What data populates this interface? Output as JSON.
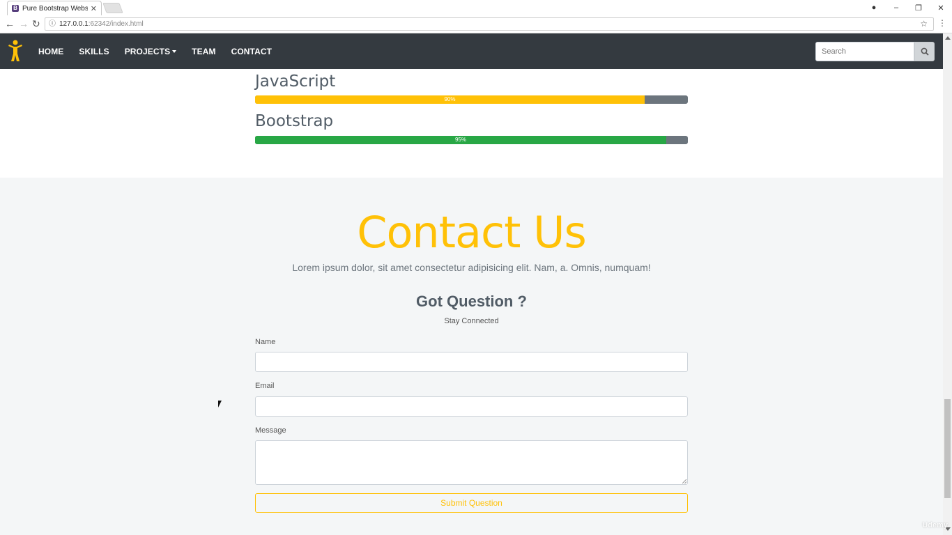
{
  "browser": {
    "tab_title": "Pure Bootstrap Website",
    "tab_favicon": "B",
    "url_host": "127.0.0.1",
    "url_rest": ":62342/index.html"
  },
  "navbar": {
    "links": [
      "HOME",
      "SKILLS",
      "PROJECTS",
      "TEAM",
      "CONTACT"
    ],
    "search_placeholder": "Search"
  },
  "skills": [
    {
      "name": "JavaScript",
      "percent": 90,
      "label": "90%",
      "color": "#ffc107"
    },
    {
      "name": "Bootstrap",
      "percent": 95,
      "label": "95%",
      "color": "#28a745"
    }
  ],
  "contact": {
    "title": "Contact Us",
    "lead": "Lorem ipsum dolor, sit amet consectetur adipisicing elit. Nam, a. Omnis, numquam!",
    "subtitle": "Got Question ?",
    "tagline": "Stay Connected",
    "name_label": "Name",
    "email_label": "Email",
    "message_label": "Message",
    "submit_label": "Submit Question"
  },
  "colors": {
    "accent": "#ffc107",
    "success": "#28a745",
    "dark": "#343a40",
    "track": "#6c757d"
  },
  "watermark": "Udemy"
}
